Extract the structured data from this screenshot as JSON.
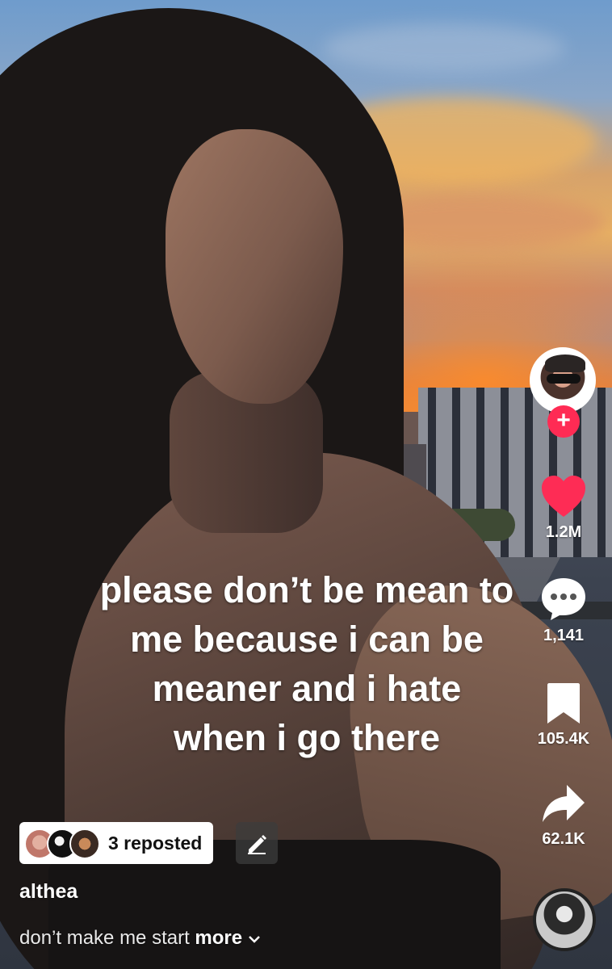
{
  "video": {
    "overlay_text_lines": [
      "please don’t be mean to",
      "me because i can be",
      "meaner and i hate",
      "when i go there"
    ]
  },
  "side_actions": {
    "follow_symbol": "+",
    "likes": "1.2M",
    "comments": "1,141",
    "saves": "105.4K",
    "shares": "62.1K",
    "icons": {
      "like": "heart-icon",
      "comment": "comment-bubble-icon",
      "save": "bookmark-icon",
      "share": "share-arrow-icon"
    },
    "colors": {
      "like": "#fe2c55",
      "follow": "#ff2b54"
    }
  },
  "repost": {
    "label": "3 reposted"
  },
  "post": {
    "username": "althea",
    "caption": "don’t make me start",
    "more_label": "more"
  }
}
